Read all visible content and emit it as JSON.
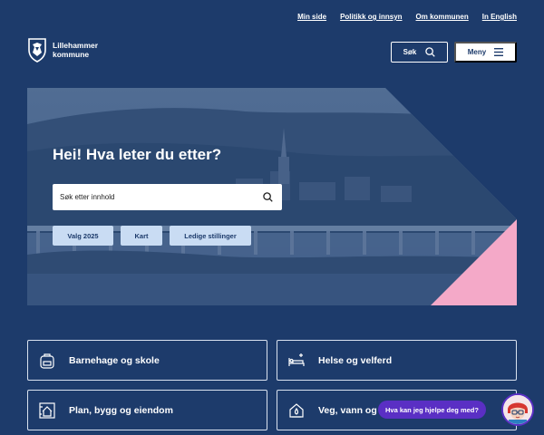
{
  "top_links": [
    "Min side",
    "Politikk og innsyn",
    "Om kommunen",
    "In English"
  ],
  "logo": {
    "line1": "Lillehammer",
    "line2": "kommune"
  },
  "header": {
    "search_label": "Søk",
    "menu_label": "Meny"
  },
  "hero": {
    "title": "Hei! Hva leter du etter?",
    "search_placeholder": "Søk etter innhold",
    "quick_links": [
      "Valg 2025",
      "Kart",
      "Ledige stillinger"
    ]
  },
  "categories": [
    {
      "label": "Barnehage og skole",
      "icon": "backpack-icon"
    },
    {
      "label": "Helse og velferd",
      "icon": "bed-icon"
    },
    {
      "label": "Plan, bygg og eiendom",
      "icon": "house-plan-icon"
    },
    {
      "label": "Veg, vann og",
      "icon": "water-house-icon"
    }
  ],
  "chat": {
    "prompt": "Hva kan jeg hjelpe deg med?"
  },
  "colors": {
    "background": "#1d3b6b",
    "chip": "#c9dcf3",
    "accent_pink": "#f4a9c8",
    "chat": "#5a2fc4"
  }
}
